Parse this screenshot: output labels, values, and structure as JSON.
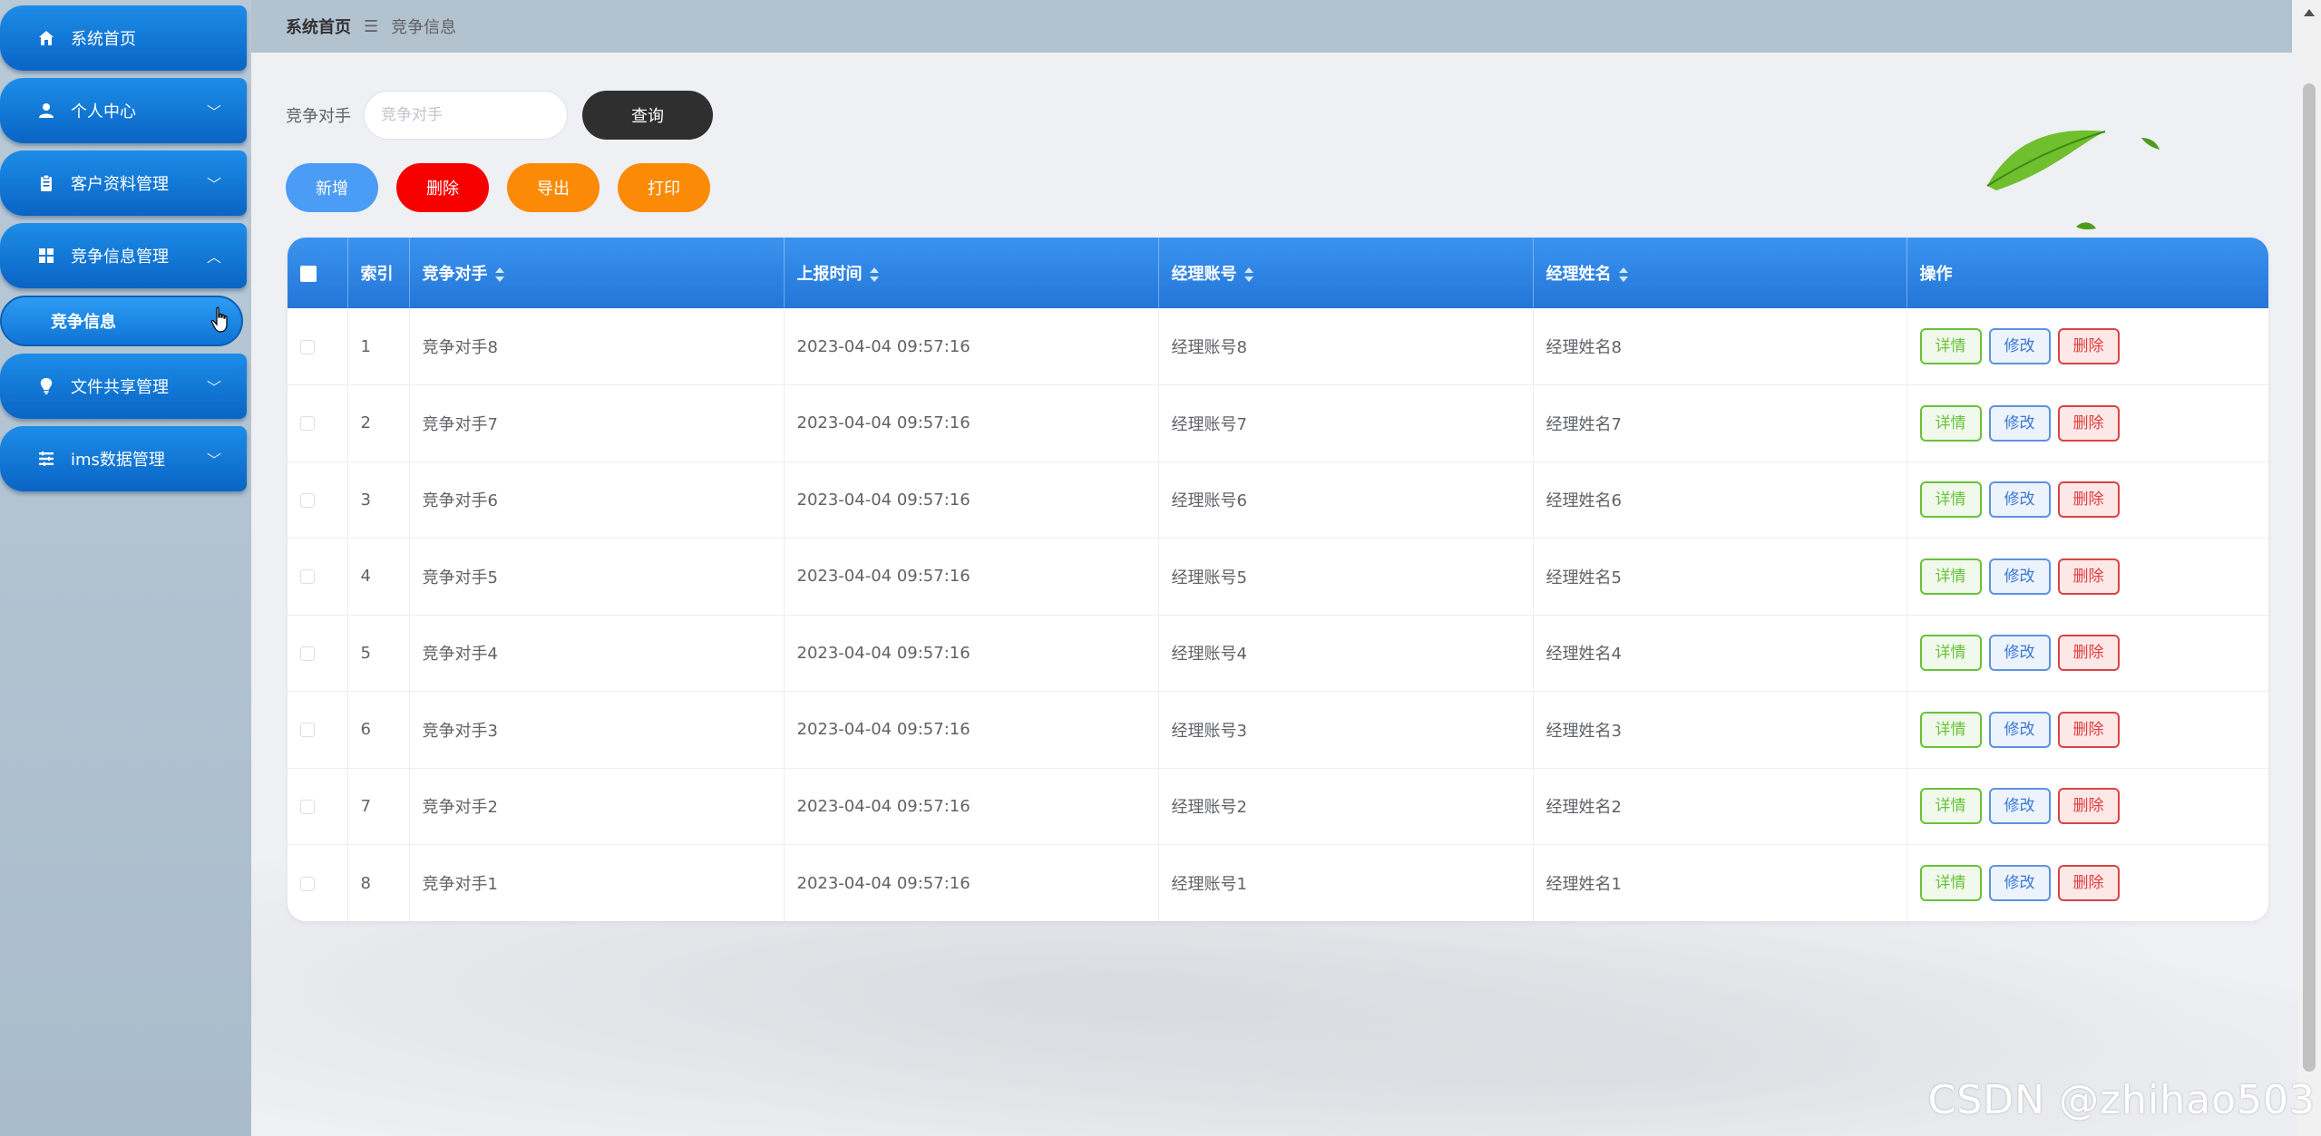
{
  "sidebar": {
    "items": [
      {
        "label": "系统首页",
        "icon": "home-icon"
      },
      {
        "label": "个人中心",
        "icon": "user-icon"
      },
      {
        "label": "客户资料管理",
        "icon": "clipboard-icon"
      },
      {
        "label": "竞争信息管理",
        "icon": "grid-icon"
      },
      {
        "label": "竞争信息"
      },
      {
        "label": "文件共享管理",
        "icon": "bulb-icon"
      },
      {
        "label": "ims数据管理",
        "icon": "list-icon"
      }
    ]
  },
  "breadcrumb": {
    "home": "系统首页",
    "separator": "☰",
    "current": "竞争信息"
  },
  "search": {
    "label": "竞争对手",
    "placeholder": "竞争对手",
    "value": "",
    "button": "查询"
  },
  "actions": {
    "add": "新增",
    "delete": "删除",
    "export": "导出",
    "print": "打印"
  },
  "table": {
    "headers": [
      "索引",
      "竞争对手",
      "上报时间",
      "经理账号",
      "经理姓名",
      "操作"
    ],
    "row_buttons": {
      "detail": "详情",
      "edit": "修改",
      "remove": "删除"
    },
    "rows": [
      {
        "index": "1",
        "rival": "竞争对手8",
        "time": "2023-04-04 09:57:16",
        "account": "经理账号8",
        "name": "经理姓名8"
      },
      {
        "index": "2",
        "rival": "竞争对手7",
        "time": "2023-04-04 09:57:16",
        "account": "经理账号7",
        "name": "经理姓名7"
      },
      {
        "index": "3",
        "rival": "竞争对手6",
        "time": "2023-04-04 09:57:16",
        "account": "经理账号6",
        "name": "经理姓名6"
      },
      {
        "index": "4",
        "rival": "竞争对手5",
        "time": "2023-04-04 09:57:16",
        "account": "经理账号5",
        "name": "经理姓名5"
      },
      {
        "index": "5",
        "rival": "竞争对手4",
        "time": "2023-04-04 09:57:16",
        "account": "经理账号4",
        "name": "经理姓名4"
      },
      {
        "index": "6",
        "rival": "竞争对手3",
        "time": "2023-04-04 09:57:16",
        "account": "经理账号3",
        "name": "经理姓名3"
      },
      {
        "index": "7",
        "rival": "竞争对手2",
        "time": "2023-04-04 09:57:16",
        "account": "经理账号2",
        "name": "经理姓名2"
      },
      {
        "index": "8",
        "rival": "竞争对手1",
        "time": "2023-04-04 09:57:16",
        "account": "经理账号1",
        "name": "经理姓名1"
      }
    ]
  },
  "watermark": "CSDN @zhihao503",
  "colors": {
    "menu_blue": "#0a64c4",
    "add": "#4b9cf5",
    "delete": "#f70000",
    "export": "#fb8a07",
    "query": "#2f2f2f",
    "table_header": "#2476d8"
  }
}
